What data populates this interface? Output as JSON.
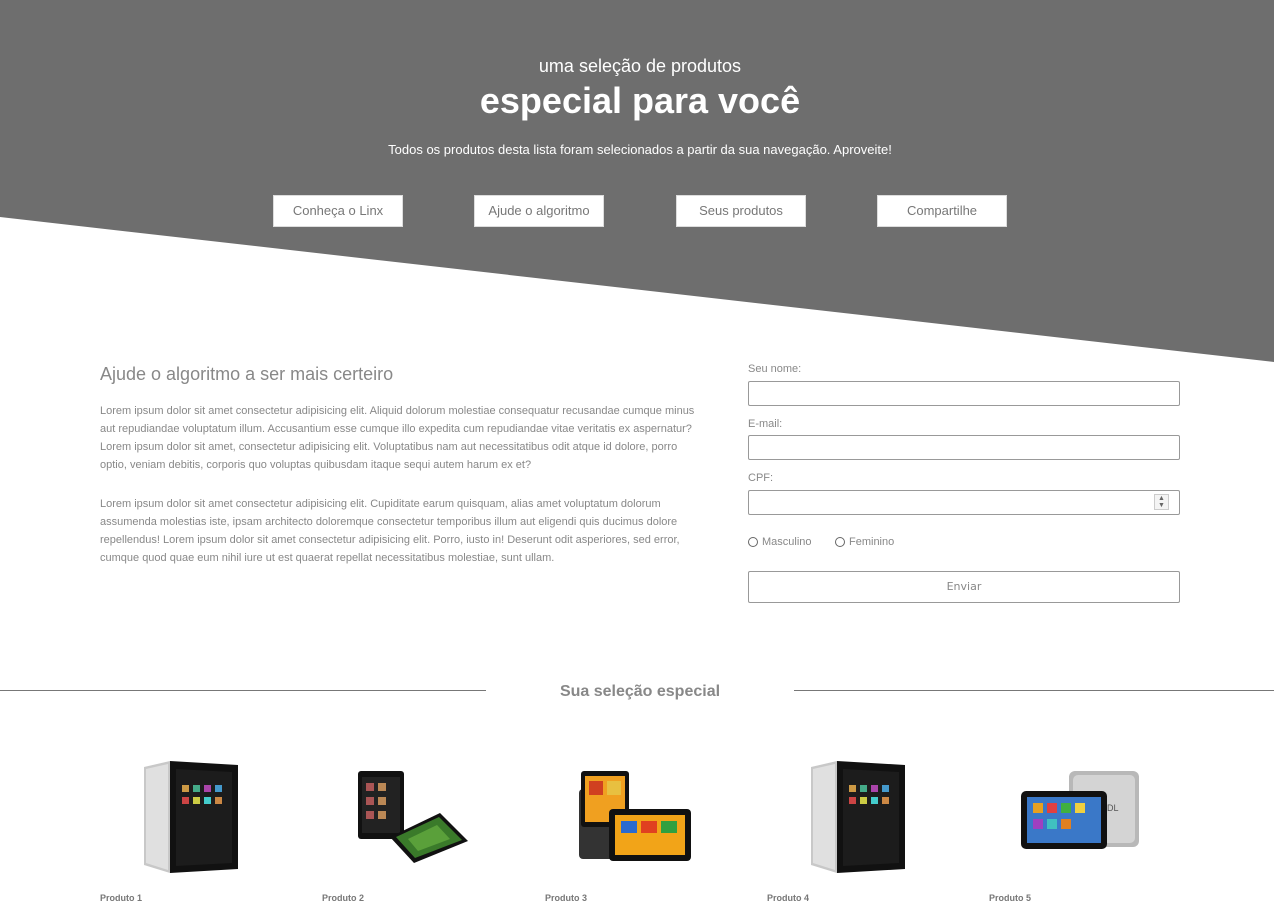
{
  "hero": {
    "subtitle": "uma seleção de produtos",
    "title": "especial para você",
    "description": "Todos os produtos desta lista foram selecionados a partir da sua navegação. Aproveite!",
    "buttons": [
      "Conheça o Linx",
      "Ajude o algoritmo",
      "Seus produtos",
      "Compartilhe"
    ],
    "background_color": "#6e6e6e"
  },
  "algorithm": {
    "title": "Ajude o algoritmo a ser mais certeiro",
    "paragraph1": "Lorem ipsum dolor sit amet consectetur adipisicing elit. Aliquid dolorum molestiae consequatur recusandae cumque minus aut repudiandae voluptatum illum. Accusantium esse cumque illo expedita cum repudiandae vitae veritatis ex aspernatur? Lorem ipsum dolor sit amet, consectetur adipisicing elit. Voluptatibus nam aut necessitatibus odit atque id dolore, porro optio, veniam debitis, corporis quo voluptas quibusdam itaque sequi autem harum ex et?",
    "paragraph2": "Lorem ipsum dolor sit amet consectetur adipisicing elit. Cupiditate earum quisquam, alias amet voluptatum dolorum assumenda molestias iste, ipsam architecto doloremque consectetur temporibus illum aut eligendi quis ducimus dolore repellendus! Lorem ipsum dolor sit amet consectetur adipisicing elit. Porro, iusto in! Deserunt odit asperiores, sed error, cumque quod quae eum nihil iure ut est quaerat repellat necessitatibus molestiae, sunt ullam."
  },
  "form": {
    "name_label": "Seu nome:",
    "name_value": "",
    "email_label": "E-mail:",
    "email_value": "",
    "cpf_label": "CPF:",
    "cpf_value": "",
    "gender_options": [
      "Masculino",
      "Feminino"
    ],
    "submit_label": "Enviar"
  },
  "selection": {
    "title": "Sua seleção especial",
    "products": [
      {
        "name": "Produto 1",
        "icon": "tablet-silver-portrait"
      },
      {
        "name": "Produto 2",
        "icon": "tablet-pair-black"
      },
      {
        "name": "Produto 3",
        "icon": "tablet-with-case"
      },
      {
        "name": "Produto 4",
        "icon": "tablet-silver-portrait"
      },
      {
        "name": "Produto 5",
        "icon": "tablet-silver-landscape"
      }
    ]
  }
}
